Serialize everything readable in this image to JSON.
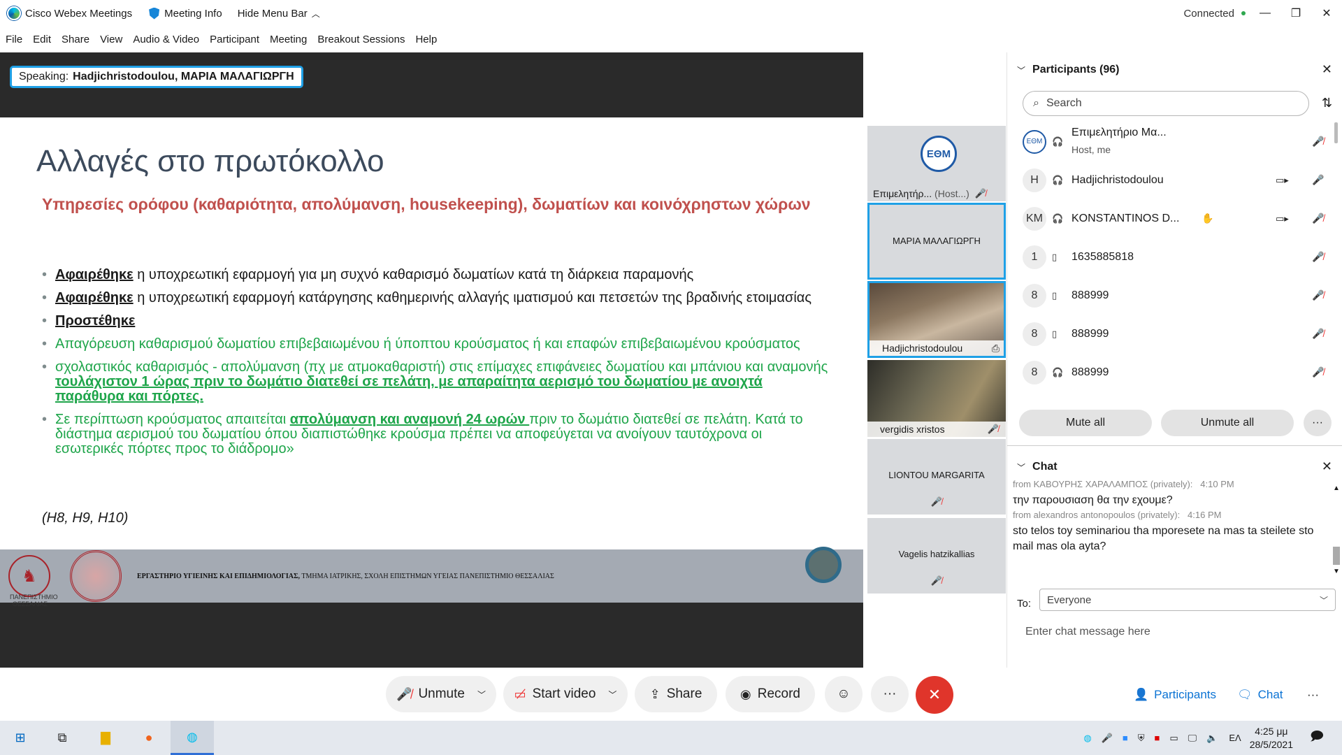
{
  "titlebar": {
    "app_name": "Cisco Webex Meetings",
    "meeting_info": "Meeting Info",
    "hide_menu": "Hide Menu Bar",
    "status": "Connected"
  },
  "menu": [
    "File",
    "Edit",
    "Share",
    "View",
    "Audio & Video",
    "Participant",
    "Meeting",
    "Breakout Sessions",
    "Help"
  ],
  "speaking": {
    "label": "Speaking:",
    "name": "Hadjichristodoulou, ΜΑΡΙΑ ΜΑΛΑΓΙΩΡΓΗ"
  },
  "slide": {
    "title": "Αλλαγές στο πρωτόκολλο",
    "subtitle": "Υπηρεσίες ορόφου (καθαριότητα, απολύμανση, housekeeping), δωματίων και κοινόχρηστων χώρων",
    "b1_bold": "Αφαιρέθηκε",
    "b1_text": " η υποχρεωτική εφαρμογή για  μη συχνό καθαρισμό δωματίων κατά τη διάρκεια παραμονής",
    "b2_bold": "Αφαιρέθηκε",
    "b2_text": " η υποχρεωτική εφαρμογή κατάργησης καθημερινής αλλαγής ιματισμού και πετσετών της βραδινής ετοιμασίας",
    "b3_bold": "Προστέθηκε",
    "b4_text": "Απαγόρευση καθαρισμού δωματίου επιβεβαιωμένου ή ύποπτου κρούσματος ή και επαφών επιβεβαιωμένου κρούσματος",
    "b5_text": "σχολαστικός καθαρισμός - απολύμανση (πχ με ατμοκαθαριστή) στις επίμαχες επιφάνειες δωματίου και μπάνιου και αναμονής ",
    "b5_bold": "τουλάχιστον 1 ώρας πριν το δωμάτιο διατεθεί σε πελάτη, με απαραίτητα αερισμό του δωματίου με ανοιχτά παράθυρα και πόρτες.",
    "b6_text1": "Σε περίπτωση κρούσματος απαιτείται ",
    "b6_bold": "απολύμανση και αναμονή 24 ωρών ",
    "b6_text2": "πριν το δωμάτιο διατεθεί σε πελάτη. Κατά το διάστημα αερισμού του δωματίου όπου διαπιστώθηκε κρούσμα πρέπει να αποφεύγεται να ανοίγουν ταυτόχρονα οι εσωτερικές πόρτες προς το διάδρομο»",
    "refs": "(H8, H9, H10)",
    "footer_uni": "ΠΑΝΕΠΙΣΤΗΜΙΟ ΘΕΣΣΑΛΙΑΣ",
    "footer_bold": "ΕΡΓΑΣΤΗΡΙΟ ΥΓΙΕΙΝΗΣ ΚΑΙ ΕΠΙΔΗΜΙΟΛΟΓΙΑΣ,",
    "footer_text": " ΤΜΗΜΑ ΙΑΤΡΙΚΗΣ, ΣΧΟΛΗ ΕΠΙΣΤΗΜΩΝ ΥΓΕΙΑΣ ΠΑΝΕΠΙΣΤΗΜΙΟ ΘΕΣΣΑΛΙΑΣ"
  },
  "thumbnails": {
    "t1_name": "Επιμελητήρ...",
    "t1_role": "(Host...)",
    "t2_name": "ΜΑΡΙΑ ΜΑΛΑΓΙΩΡΓΗ",
    "t3_name": "Hadjichristodoulou",
    "t4_name": "vergidis xristos",
    "t5_name": "LIONTOU MARGARITA",
    "t6_name": "Vagelis hatzikallias"
  },
  "participants": {
    "title": "Participants (96)",
    "search_placeholder": "Search",
    "rows": [
      {
        "avatar": "ΕΘΜ",
        "name": "Επιμελητήριο Μα...",
        "sub": "Host, me"
      },
      {
        "avatar": "H",
        "name": "Hadjichristodoulou",
        "sub": ""
      },
      {
        "avatar": "KM",
        "name": "KONSTANTINOS D...",
        "sub": ""
      },
      {
        "avatar": "1",
        "name": "1635885818",
        "sub": ""
      },
      {
        "avatar": "8",
        "name": "888999",
        "sub": ""
      },
      {
        "avatar": "8",
        "name": "888999",
        "sub": ""
      },
      {
        "avatar": "8",
        "name": "888999",
        "sub": ""
      }
    ],
    "mute_all": "Mute all",
    "unmute_all": "Unmute all",
    "more": "···"
  },
  "chat": {
    "title": "Chat",
    "m1_from": "from ΚΑΒΟΥΡΗΣ ΧΑΡΑΛΑΜΠΟΣ (privately):",
    "m1_time": "4:10 PM",
    "m1_text": "την παρουσιαση θα την εχουμε?",
    "m2_from": "from alexandros antonopoulos (privately):",
    "m2_time": "4:16 PM",
    "m2_text": "sto telos toy seminariou tha mporesete na mas ta steilete sto mail mas ola ayta?",
    "to_label": "To:",
    "to_value": "Everyone",
    "input_placeholder": "Enter chat message here"
  },
  "controls": {
    "unmute": "Unmute",
    "start_video": "Start video",
    "share": "Share",
    "record": "Record",
    "participants": "Participants",
    "chat": "Chat"
  },
  "taskbar": {
    "lang": "ΕΛ",
    "time": "4:25 μμ",
    "date": "28/5/2021"
  },
  "colors": {
    "accent": "#1fa0e6",
    "end_call": "#e0352b",
    "slide_red": "#c0504d",
    "slide_green": "#1ea54a"
  }
}
